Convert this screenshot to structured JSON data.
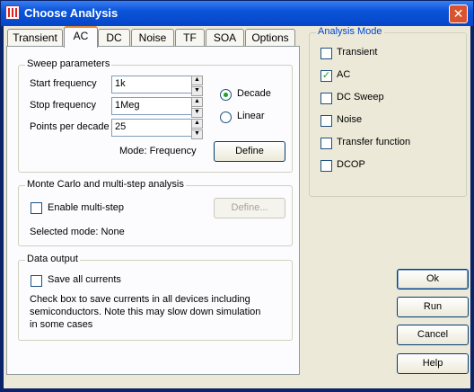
{
  "window": {
    "title": "Choose Analysis"
  },
  "tabs": [
    {
      "label": "Transient"
    },
    {
      "label": "AC"
    },
    {
      "label": "DC"
    },
    {
      "label": "Noise"
    },
    {
      "label": "TF"
    },
    {
      "label": "SOA"
    },
    {
      "label": "Options"
    }
  ],
  "sweep": {
    "title": "Sweep parameters",
    "start_label": "Start frequency",
    "start_value": "1k",
    "stop_label": "Stop frequency",
    "stop_value": "1Meg",
    "ppd_label": "Points per decade",
    "ppd_value": "25",
    "decade_label": "Decade",
    "linear_label": "Linear",
    "mode_text": "Mode: Frequency",
    "define_label": "Define"
  },
  "montecarlo": {
    "title": "Monte Carlo and multi-step analysis",
    "enable_label": "Enable multi-step",
    "define_label": "Define...",
    "selected_mode": "Selected mode: None"
  },
  "output": {
    "title": "Data output",
    "save_label": "Save all currents",
    "note_line1": "Check box to save currents in all devices including",
    "note_line2": "semiconductors. Note this may slow down simulation",
    "note_line3": "in some cases"
  },
  "analysis_mode": {
    "title": "Analysis Mode",
    "items": [
      {
        "label": "Transient",
        "checked": false
      },
      {
        "label": "AC",
        "checked": true
      },
      {
        "label": "DC Sweep",
        "checked": false
      },
      {
        "label": "Noise",
        "checked": false
      },
      {
        "label": "Transfer function",
        "checked": false
      },
      {
        "label": "DCOP",
        "checked": false
      }
    ]
  },
  "buttons": {
    "ok": "Ok",
    "run": "Run",
    "cancel": "Cancel",
    "help": "Help"
  }
}
